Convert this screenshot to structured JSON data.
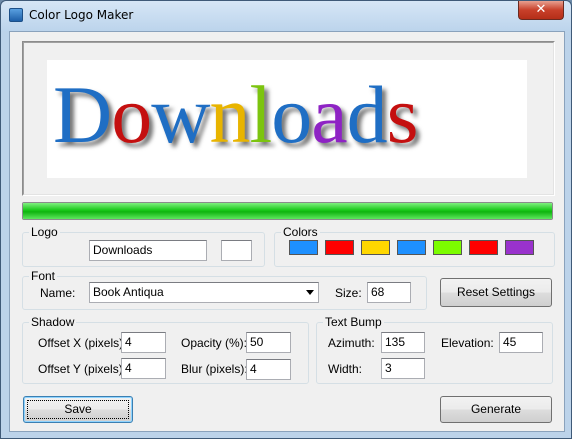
{
  "window": {
    "title": "Color Logo Maker",
    "close_glyph": "✕"
  },
  "preview": {
    "text": "Downloads",
    "letter_colors": [
      "#1f6ec4",
      "#c40f0f",
      "#1f6ec4",
      "#e8b400",
      "#7cc40f",
      "#1f6ec4",
      "#8e23c4",
      "#1f6ec4",
      "#c40f0f"
    ],
    "letters": [
      "D",
      "o",
      "w",
      "n",
      "l",
      "o",
      "a",
      "d",
      "s"
    ]
  },
  "progress": {
    "value_fraction": 1.0,
    "color": "#19c819"
  },
  "logo_group": {
    "legend": "Logo",
    "text_value": "Downloads",
    "extra_value": ""
  },
  "colors_group": {
    "legend": "Colors",
    "swatches": [
      "#1e90ff",
      "#ff0000",
      "#ffd700",
      "#1e90ff",
      "#7cfc00",
      "#ff0000",
      "#9932cc"
    ]
  },
  "font_group": {
    "legend": "Font",
    "name_label": "Name:",
    "name_value": "Book Antiqua",
    "size_label": "Size:",
    "size_value": "68"
  },
  "reset_button": {
    "label": "Reset Settings"
  },
  "shadow_group": {
    "legend": "Shadow",
    "offset_x_label": "Offset X (pixels):",
    "offset_x_value": "4",
    "offset_y_label": "Offset Y (pixels):",
    "offset_y_value": "4",
    "opacity_label": "Opacity (%):",
    "opacity_value": "50",
    "blur_label": "Blur (pixels):",
    "blur_value": "4"
  },
  "bump_group": {
    "legend": "Text Bump",
    "azimuth_label": "Azimuth:",
    "azimuth_value": "135",
    "elevation_label": "Elevation:",
    "elevation_value": "45",
    "width_label": "Width:",
    "width_value": "3"
  },
  "save_button": {
    "label": "Save"
  },
  "generate_button": {
    "label": "Generate"
  }
}
